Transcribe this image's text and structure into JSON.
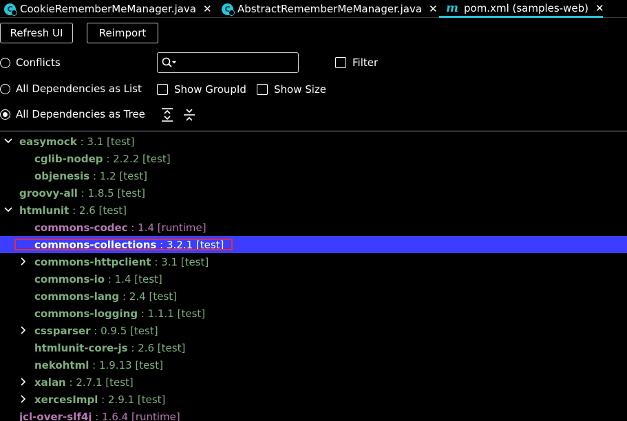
{
  "tabs": [
    {
      "label": "CookieRememberMeManager.java",
      "icon": "java-class-icon",
      "active": false
    },
    {
      "label": "AbstractRememberMeManager.java",
      "icon": "java-class-icon",
      "active": false
    },
    {
      "label": "pom.xml (samples-web)",
      "icon": "maven-icon",
      "active": true
    }
  ],
  "tab_icon_letter": "C",
  "tab_maven_letter": "m",
  "toolbar": {
    "refresh_label": "Refresh UI",
    "reimport_label": "Reimport"
  },
  "options": {
    "conflicts_label": "Conflicts",
    "all_list_label": "All Dependencies as List",
    "all_tree_label": "All Dependencies as Tree",
    "filter_label": "Filter",
    "show_groupid_label": "Show GroupId",
    "show_size_label": "Show Size",
    "selected_view": "All Dependencies as Tree"
  },
  "search": {
    "value": "",
    "placeholder": ""
  },
  "tree": [
    {
      "name": "easymock",
      "version": " : 3.1 [test]",
      "level": 0,
      "arrow": "down",
      "color": "g"
    },
    {
      "name": "cglib-nodep",
      "version": " : 2.2.2 [test]",
      "level": 1,
      "arrow": "",
      "color": "g"
    },
    {
      "name": "objenesis",
      "version": " : 1.2 [test]",
      "level": 1,
      "arrow": "",
      "color": "g"
    },
    {
      "name": "groovy-all",
      "version": " : 1.8.5 [test]",
      "level": 0,
      "arrow": "",
      "color": "g"
    },
    {
      "name": "htmlunit",
      "version": " : 2.6 [test]",
      "level": 0,
      "arrow": "down",
      "color": "g"
    },
    {
      "name": "commons-codec",
      "version": " : 1.4 [runtime]",
      "level": 1,
      "arrow": "",
      "color": "p"
    },
    {
      "name": "commons-collections",
      "version": " : 3.2.1 [test]",
      "level": 1,
      "arrow": "",
      "color": "w",
      "selected": true
    },
    {
      "name": "commons-httpclient",
      "version": " : 3.1 [test]",
      "level": 1,
      "arrow": "right",
      "color": "g"
    },
    {
      "name": "commons-io",
      "version": " : 1.4 [test]",
      "level": 1,
      "arrow": "",
      "color": "g"
    },
    {
      "name": "commons-lang",
      "version": " : 2.4 [test]",
      "level": 1,
      "arrow": "",
      "color": "g"
    },
    {
      "name": "commons-logging",
      "version": " : 1.1.1 [test]",
      "level": 1,
      "arrow": "",
      "color": "g"
    },
    {
      "name": "cssparser",
      "version": " : 0.9.5 [test]",
      "level": 1,
      "arrow": "right",
      "color": "g"
    },
    {
      "name": "htmlunit-core-js",
      "version": " : 2.6 [test]",
      "level": 1,
      "arrow": "",
      "color": "g"
    },
    {
      "name": "nekohtml",
      "version": " : 1.9.13 [test]",
      "level": 1,
      "arrow": "",
      "color": "g"
    },
    {
      "name": "xalan",
      "version": " : 2.7.1 [test]",
      "level": 1,
      "arrow": "right",
      "color": "g"
    },
    {
      "name": "xercesImpl",
      "version": " : 2.9.1 [test]",
      "level": 1,
      "arrow": "right",
      "color": "g"
    },
    {
      "name": "jcl-over-slf4j",
      "version": " : 1.6.4 [runtime]",
      "level": 0,
      "arrow": "",
      "color": "p"
    }
  ],
  "colors": {
    "accent": "#2bc4d6",
    "selection": "#3d3dff",
    "test": "#7fae7f",
    "runtime": "#b97ab5",
    "highlight": "#e0303a"
  }
}
